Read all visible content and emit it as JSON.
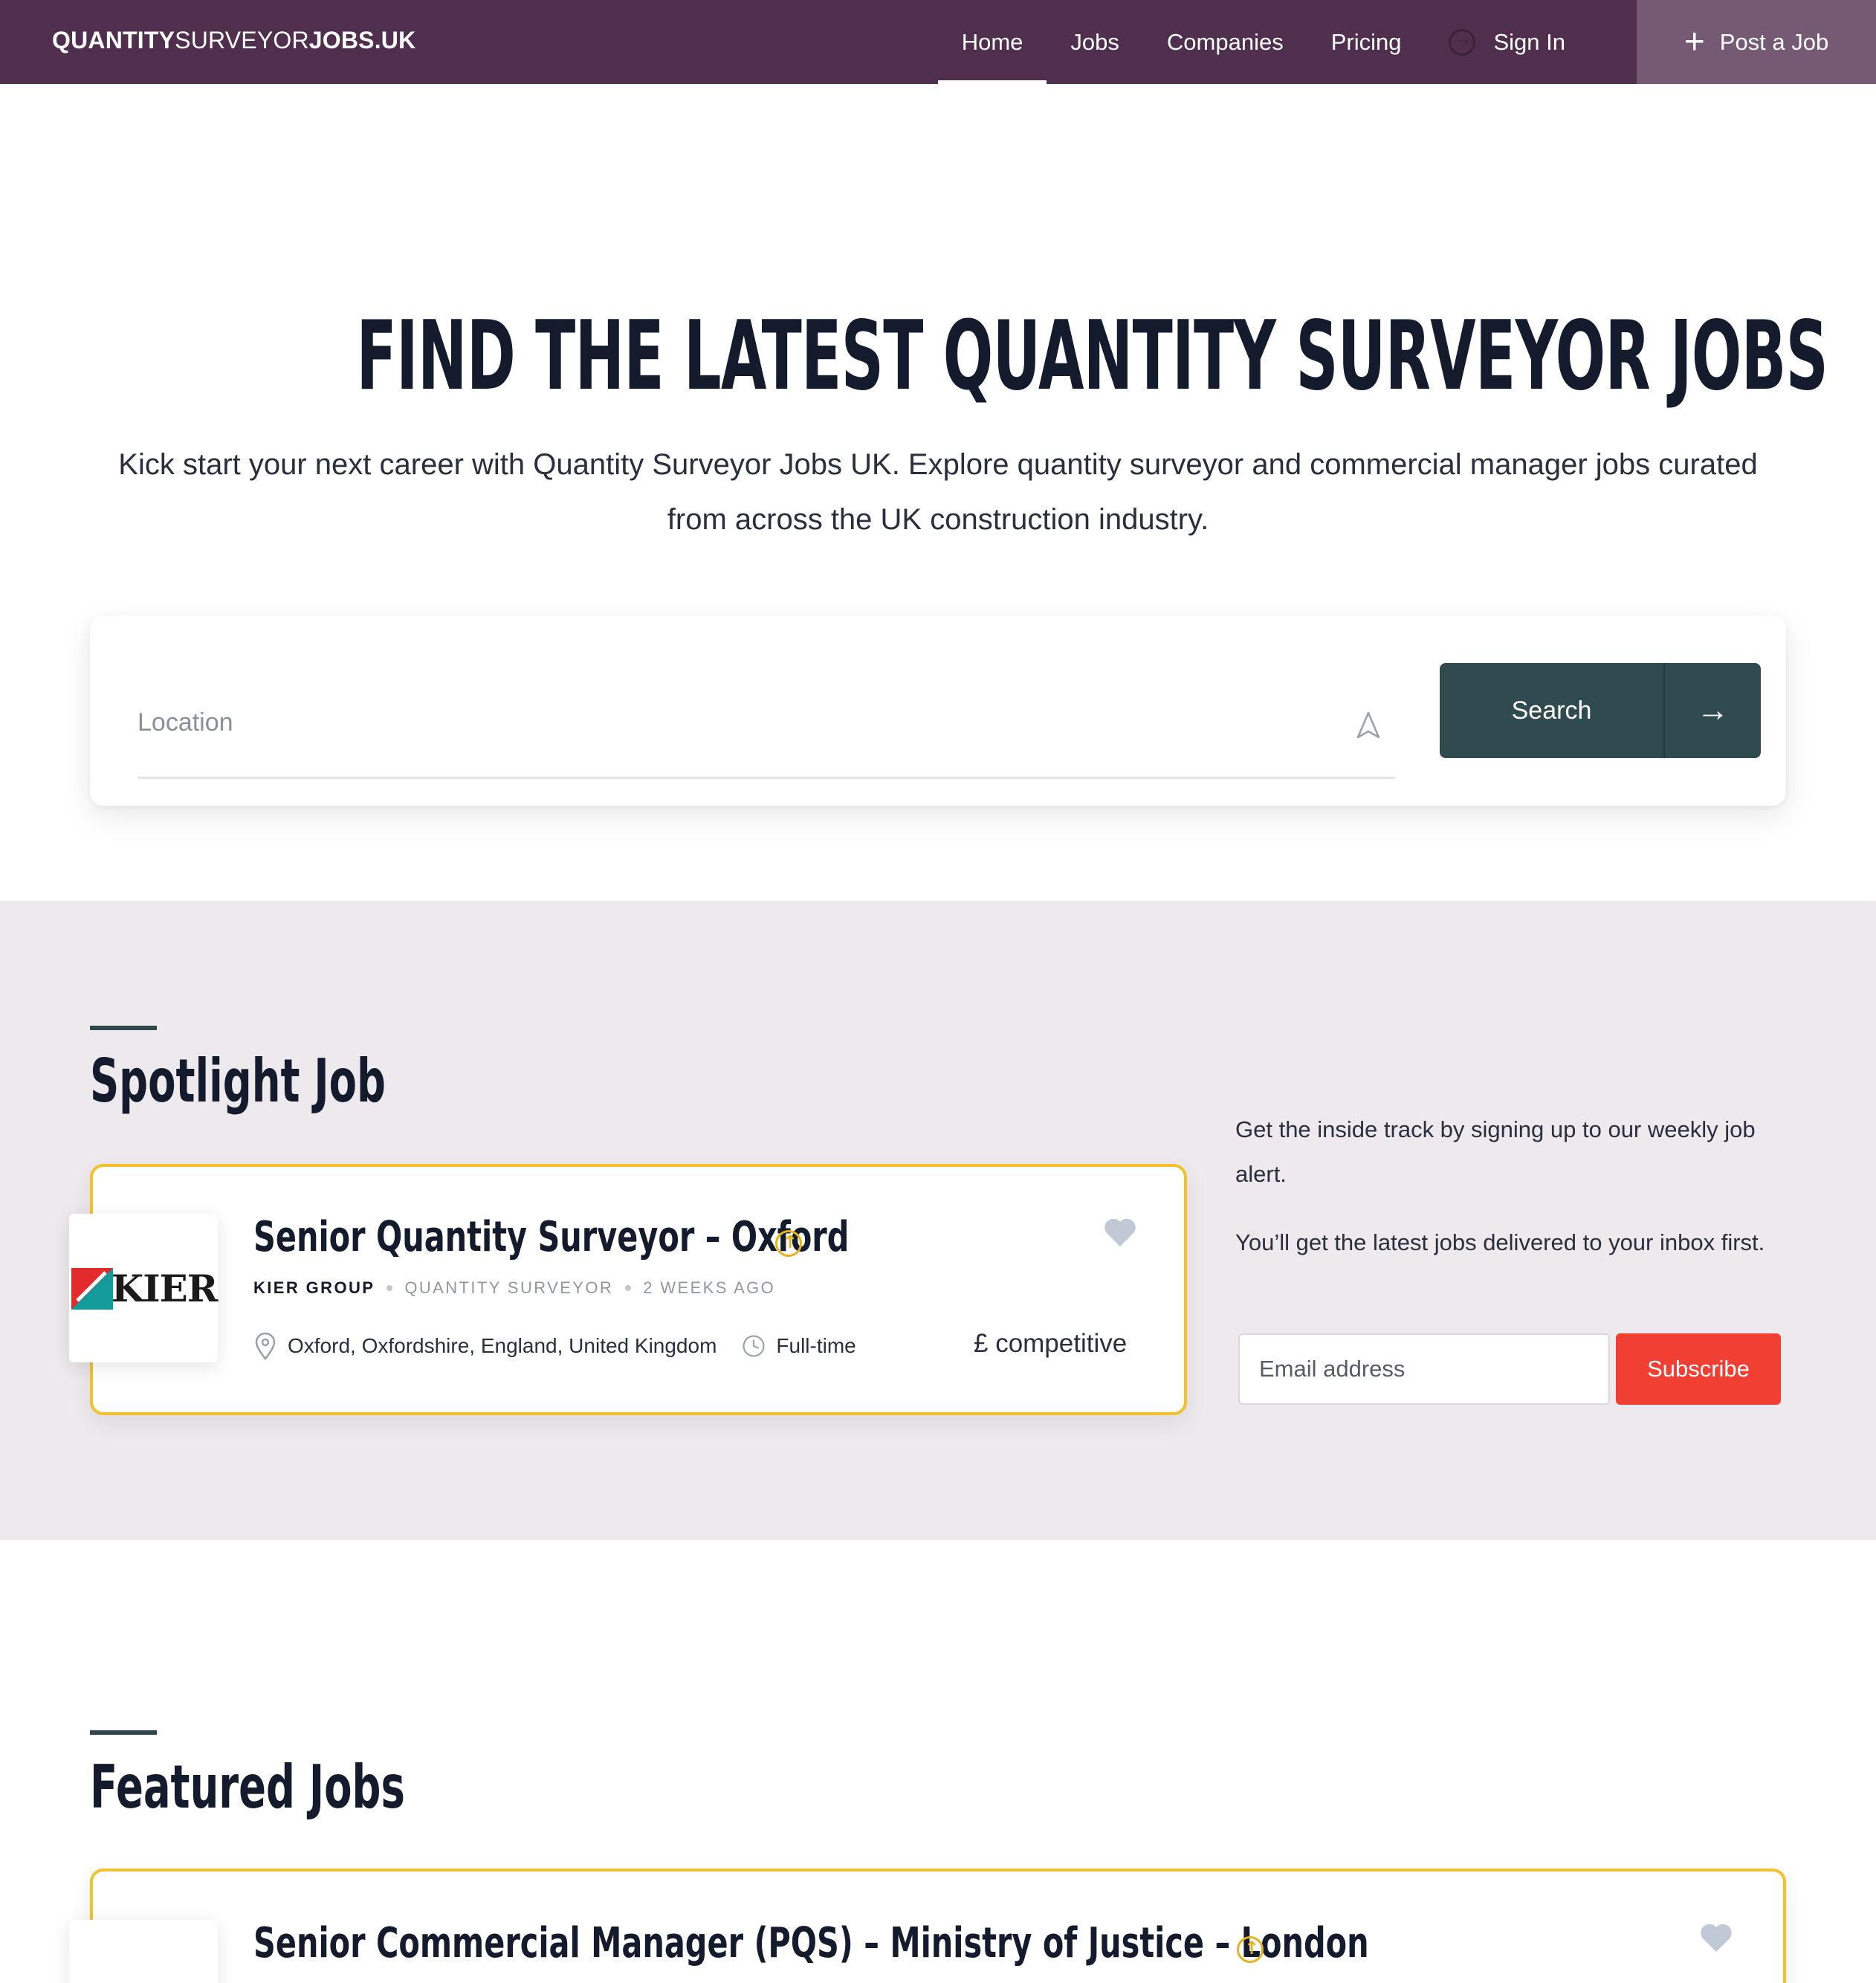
{
  "brand": {
    "part1": "QUANTITY",
    "part2": "SURVEYOR",
    "part3": "JOBS.UK"
  },
  "nav": {
    "items": [
      {
        "label": "Home",
        "active": true
      },
      {
        "label": "Jobs"
      },
      {
        "label": "Companies"
      },
      {
        "label": "Pricing"
      }
    ],
    "sign_in": "Sign In",
    "post_job": "Post a Job"
  },
  "hero": {
    "title": "FIND THE LATEST QUANTITY SURVEYOR JOBS",
    "subtitle": "Kick start your next career with Quantity Surveyor Jobs UK. Explore quantity surveyor and commercial manager jobs curated from across the UK construction industry."
  },
  "search": {
    "location_placeholder": "Location",
    "location_value": "",
    "button_label": "Search"
  },
  "spotlight": {
    "heading": "Spotlight Job",
    "job": {
      "title": "Senior Quantity Surveyor – Oxford",
      "company": "KIER GROUP",
      "category": "QUANTITY SURVEYOR",
      "posted": "2 WEEKS AGO",
      "location": "Oxford, Oxfordshire, England, United Kingdom",
      "type": "Full-time",
      "salary": "£ competitive",
      "logo_text": "KIER"
    }
  },
  "newsletter": {
    "line1": "Get the inside track by signing up to our weekly job alert.",
    "line2": "You’ll get the latest jobs delivered to your inbox first.",
    "email_placeholder": "Email address",
    "subscribe_label": "Subscribe"
  },
  "featured": {
    "heading": "Featured Jobs",
    "jobs": [
      {
        "title": "Senior Commercial Manager (PQS) – Ministry of Justice – London"
      }
    ]
  },
  "colors": {
    "nav_bg": "#4f2f4d",
    "post_job_bg": "#765a73",
    "search_btn": "#304b50",
    "section_bg": "#ede9ed",
    "highlight_border": "#f3c12b",
    "subscribe": "#f13f33"
  },
  "icons": [
    "sign-in-icon",
    "plus-icon",
    "locate-icon",
    "arrow-right-icon",
    "heart-icon",
    "boost-icon",
    "map-pin-icon",
    "clock-icon"
  ]
}
